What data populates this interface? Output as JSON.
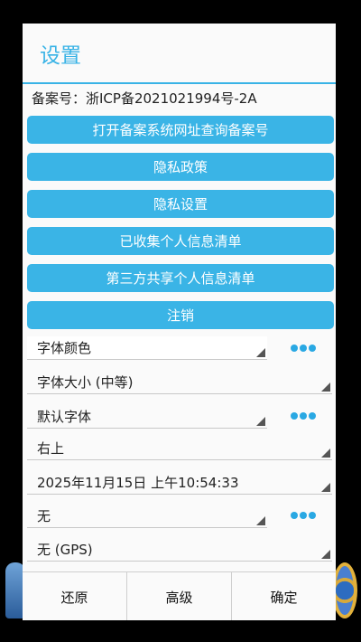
{
  "dialog": {
    "title": "设置",
    "record": "备案号：浙ICP备2021021994号-2A"
  },
  "buttons": [
    {
      "label": "打开备案系统网址查询备案号"
    },
    {
      "label": "隐私政策"
    },
    {
      "label": "隐私设置"
    },
    {
      "label": "已收集个人信息清单"
    },
    {
      "label": "第三方共享个人信息清单"
    },
    {
      "label": "注销"
    }
  ],
  "spinners": {
    "font_color": "字体颜色",
    "font_size": "字体大小 (中等)",
    "font_face": "默认字体",
    "position": "右上",
    "datetime": "2025年11月15日 上午10:54:33",
    "option_none": "无",
    "gps": "无 (GPS)"
  },
  "footer": {
    "restore": "还原",
    "advanced": "高级",
    "confirm": "确定"
  },
  "colors": {
    "accent": "#39b3e6",
    "dots": "#29a8e3"
  }
}
